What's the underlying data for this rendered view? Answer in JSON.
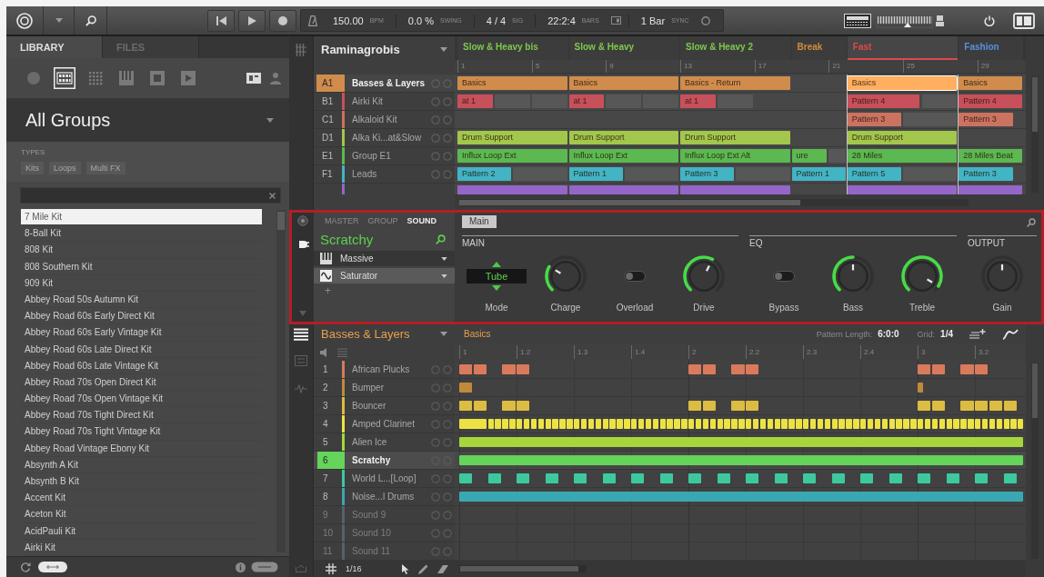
{
  "topbar": {
    "display": [
      {
        "value": "150.00",
        "unit": "BPM"
      },
      {
        "value": "0.0 %",
        "unit": "SWING"
      },
      {
        "value": "4 / 4",
        "unit": "SIG"
      },
      {
        "value": "22:2:4",
        "unit": "BARS"
      },
      {
        "value": "1 Bar",
        "unit": "SYNC"
      }
    ],
    "master_volume": {
      "level": 0.55
    }
  },
  "library": {
    "tabs": [
      {
        "label": "LIBRARY",
        "selected": true
      },
      {
        "label": "FILES",
        "selected": false
      }
    ],
    "view_buttons": [
      {
        "selected": false
      },
      {
        "selected": true
      },
      {
        "selected": false
      },
      {
        "selected": false
      },
      {
        "selected": false
      },
      {
        "selected": false
      }
    ],
    "filter": "All Groups",
    "types_label": "TYPES",
    "tags": [
      {
        "label": "Kits",
        "selected": false
      },
      {
        "label": "Loops",
        "selected": false
      },
      {
        "label": "Multi FX",
        "selected": false
      }
    ],
    "items": [
      {
        "label": "7 Mile Kit",
        "selected": true
      },
      {
        "label": "8-Ball Kit",
        "selected": false
      },
      {
        "label": "808 Kit",
        "selected": false
      },
      {
        "label": "808 Southern Kit",
        "selected": false
      },
      {
        "label": "909 Kit",
        "selected": false
      },
      {
        "label": "Abbey Road 50s Autumn Kit",
        "selected": false
      },
      {
        "label": "Abbey Road 60s Early Direct Kit",
        "selected": false
      },
      {
        "label": "Abbey Road 60s Early Vintage Kit",
        "selected": false
      },
      {
        "label": "Abbey Road 60s Late Direct Kit",
        "selected": false
      },
      {
        "label": "Abbey Road 60s Late Vintage Kit",
        "selected": false
      },
      {
        "label": "Abbey Road 70s Open Direct Kit",
        "selected": false
      },
      {
        "label": "Abbey Road 70s Open Vintage Kit",
        "selected": false
      },
      {
        "label": "Abbey Road 70s Tight Direct Kit",
        "selected": false
      },
      {
        "label": "Abbey Road 70s Tight Vintage Kit",
        "selected": false
      },
      {
        "label": "Abbey Road Vintage Ebony Kit",
        "selected": false
      },
      {
        "label": "Absynth A Kit",
        "selected": false
      },
      {
        "label": "Absynth B Kit",
        "selected": false
      },
      {
        "label": "Accent Kit",
        "selected": false
      },
      {
        "label": "Aceton Kit",
        "selected": false
      },
      {
        "label": "AcidPauli Kit",
        "selected": false
      },
      {
        "label": "Airki Kit",
        "selected": false
      }
    ]
  },
  "arranger": {
    "project": "Raminagrobis",
    "scenes": [
      {
        "name": "Slow & Heavy bis",
        "color": "#7dc94c",
        "selected": false
      },
      {
        "name": "Slow & Heavy",
        "color": "#7dc94c",
        "selected": false
      },
      {
        "name": "Slow & Heavy 2",
        "color": "#7dc94c",
        "selected": false
      },
      {
        "name": "Break",
        "color": "#d68a3c",
        "selected": false
      },
      {
        "name": "Fast",
        "color": "#e0474c",
        "selected": true
      },
      {
        "name": "Fashion",
        "color": "#5b8fe0",
        "selected": false
      }
    ],
    "bar_numbers": [
      "1",
      "5",
      "9",
      "13",
      "17",
      "21",
      "25",
      "29"
    ],
    "groups": [
      {
        "code": "A1",
        "name": "Basses & Layers",
        "color": "#d08c4c",
        "selected": true,
        "clips": [
          {
            "label": "Basics",
            "selected": false
          },
          {
            "label": "Basics",
            "selected": false
          },
          {
            "label": "Basics - Return",
            "selected": false
          },
          {
            "label": "Basics",
            "selected": true
          },
          {
            "label": "Basics",
            "selected": false
          }
        ]
      },
      {
        "code": "B1",
        "name": "Airki Kit",
        "color": "#c8505a",
        "selected": false,
        "clips": [
          {
            "label": "at 1",
            "selected": false
          },
          {
            "label": "at 1",
            "selected": false
          },
          {
            "label": "at 1",
            "selected": false
          },
          {
            "label": "Pattern 4",
            "selected": false
          },
          {
            "label": "Pattern 4",
            "selected": false
          }
        ]
      },
      {
        "code": "C1",
        "name": "Alkaloid Kit",
        "color": "#cc7260",
        "selected": false,
        "clips": [
          {
            "label": "Pattern 3",
            "selected": false
          },
          {
            "label": "Pattern 3",
            "selected": false
          }
        ]
      },
      {
        "code": "D1",
        "name": "Alka Ki...at&Slow",
        "color": "#a3c64c",
        "selected": false,
        "clips": [
          {
            "label": "Drum Support",
            "selected": false
          },
          {
            "label": "Drum Support",
            "selected": false
          },
          {
            "label": "Drum Support",
            "selected": false
          },
          {
            "label": "Drum Support",
            "selected": false
          }
        ]
      },
      {
        "code": "E1",
        "name": "Group E1",
        "color": "#5cb850",
        "selected": false,
        "clips": [
          {
            "label": "Influx Loop Ext",
            "selected": false
          },
          {
            "label": "Influx Loop Ext",
            "selected": false
          },
          {
            "label": "Influx Loop Ext Alt",
            "selected": false
          },
          {
            "label": "ure",
            "selected": false
          },
          {
            "label": "28 Miles",
            "selected": false
          },
          {
            "label": "28 Miles Beat",
            "selected": false
          }
        ]
      },
      {
        "code": "F1",
        "name": "Leads",
        "color": "#42b4c4",
        "selected": false,
        "clips": [
          {
            "label": "Pattern 2",
            "selected": false
          },
          {
            "label": "Pattern 1",
            "selected": false
          },
          {
            "label": "Pattern 3",
            "selected": false
          },
          {
            "label": "Pattern 1",
            "selected": false
          },
          {
            "label": "Pattern 5",
            "selected": false
          },
          {
            "label": "Pattern 3",
            "selected": false
          }
        ]
      },
      {
        "color": "#9466c8",
        "selected": false
      }
    ]
  },
  "sound_panel": {
    "tabs": [
      {
        "label": "MASTER",
        "selected": false
      },
      {
        "label": "GROUP",
        "selected": false
      },
      {
        "label": "SOUND",
        "selected": true
      }
    ],
    "sound": "Scratchy",
    "slots": [
      {
        "kind": "instrument",
        "name": "Massive",
        "selected": false
      },
      {
        "kind": "effect",
        "name": "Saturator",
        "selected": true
      }
    ],
    "add": "+",
    "page_tabs": [
      {
        "label": "Main",
        "selected": true
      }
    ],
    "sections": [
      {
        "title": "MAIN",
        "controls": [
          {
            "kind": "selector",
            "label": "Mode",
            "value": "Tube"
          },
          {
            "kind": "knob",
            "label": "Charge",
            "level": 0.28,
            "active": true
          },
          {
            "kind": "toggle",
            "label": "Overload",
            "on": false
          },
          {
            "kind": "knob",
            "label": "Drive",
            "level": 0.6,
            "active": true
          }
        ]
      },
      {
        "title": "EQ",
        "controls": [
          {
            "kind": "toggle",
            "label": "Bypass",
            "on": false
          },
          {
            "kind": "knob",
            "label": "Bass",
            "level": 0.5,
            "active": true
          },
          {
            "kind": "knob",
            "label": "Treble",
            "level": 0.95,
            "active": true
          }
        ]
      },
      {
        "title": "OUTPUT",
        "controls": [
          {
            "kind": "knob",
            "label": "Gain",
            "level": 0.5,
            "active": false
          }
        ]
      }
    ]
  },
  "pattern_editor": {
    "group": "Basses & Layers",
    "pattern": "Basics",
    "length_label": "Pattern Length:",
    "length": "6:0:0",
    "grid_label": "Grid:",
    "grid": "1/4",
    "beats": [
      "1",
      "1.2",
      "1.3",
      "1.4",
      "2",
      "2.2",
      "2.3",
      "2.4",
      "3",
      "3.2"
    ],
    "sounds": [
      {
        "number": "1",
        "name": "African Plucks",
        "color": "#d97a5c",
        "selected": false,
        "empty": false
      },
      {
        "number": "2",
        "name": "Bumper",
        "color": "#c08a3c",
        "selected": false,
        "empty": false
      },
      {
        "number": "3",
        "name": "Bouncer",
        "color": "#dcbc42",
        "selected": false,
        "empty": false
      },
      {
        "number": "4",
        "name": "Amped Clarinet",
        "color": "#ece244",
        "selected": false,
        "empty": false
      },
      {
        "number": "5",
        "name": "Alien Ice",
        "color": "#a6d63c",
        "selected": false,
        "empty": false
      },
      {
        "number": "6",
        "name": "Scratchy",
        "color": "#64d45a",
        "selected": true,
        "empty": false
      },
      {
        "number": "7",
        "name": "World L...[Loop]",
        "color": "#3ec8a0",
        "selected": false,
        "empty": false
      },
      {
        "number": "8",
        "name": "Noise...l Drums",
        "color": "#3aa8b2",
        "selected": false,
        "empty": false
      },
      {
        "number": "9",
        "name": "Sound 9",
        "color": "#56606e",
        "selected": false,
        "empty": true
      },
      {
        "number": "10",
        "name": "Sound 10",
        "color": "#56606e",
        "selected": false,
        "empty": true
      },
      {
        "number": "11",
        "name": "Sound 11",
        "color": "#56606e",
        "selected": false,
        "empty": true
      }
    ],
    "step_size": "1/16"
  }
}
